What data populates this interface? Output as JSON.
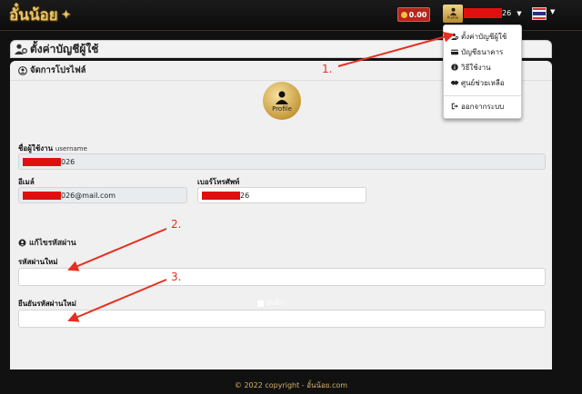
{
  "header": {
    "logo_text": "อั๋นน้อย",
    "wallet_amount": "0.00",
    "profile_label": "Profile",
    "username_suffix": "26"
  },
  "dropdown": {
    "items": [
      {
        "label": "ตั้งค่าบัญชีผู้ใช้",
        "icon": "user-gear-icon"
      },
      {
        "label": "บัญชีธนาคาร",
        "icon": "credit-card-icon"
      },
      {
        "label": "วิธีใช้งาน",
        "icon": "info-icon"
      },
      {
        "label": "ศูนย์ช่วยเหลือ",
        "icon": "handshake-icon"
      }
    ],
    "logout_label": "ออกจากระบบ"
  },
  "page": {
    "title": "ตั้งค่าบัญชีผู้ใช้",
    "profile_section": "จัดการโปรไฟล์",
    "avatar_label": "Profile",
    "username_label": "ชื่อผู้ใช้งาน",
    "username_sub": "username",
    "username_value_suffix": "026",
    "email_label": "อีเมล์",
    "email_value_suffix": "026@mail.com",
    "phone_label": "เบอร์โทรศัพท์",
    "phone_value_suffix": "26",
    "password_section": "แก้ไขรหัสผ่าน",
    "new_password_label": "รหัสผ่านใหม่",
    "confirm_password_label": "ยืนยันรหัสผ่านใหม่",
    "save_label": "บันทึก"
  },
  "annotations": [
    "1.",
    "2.",
    "3."
  ],
  "footer": {
    "copyright": "© 2022 copyright - อั๋นน้อย.com"
  },
  "colors": {
    "accent_gold": "#c79a3a",
    "alert_red": "#e53020"
  }
}
